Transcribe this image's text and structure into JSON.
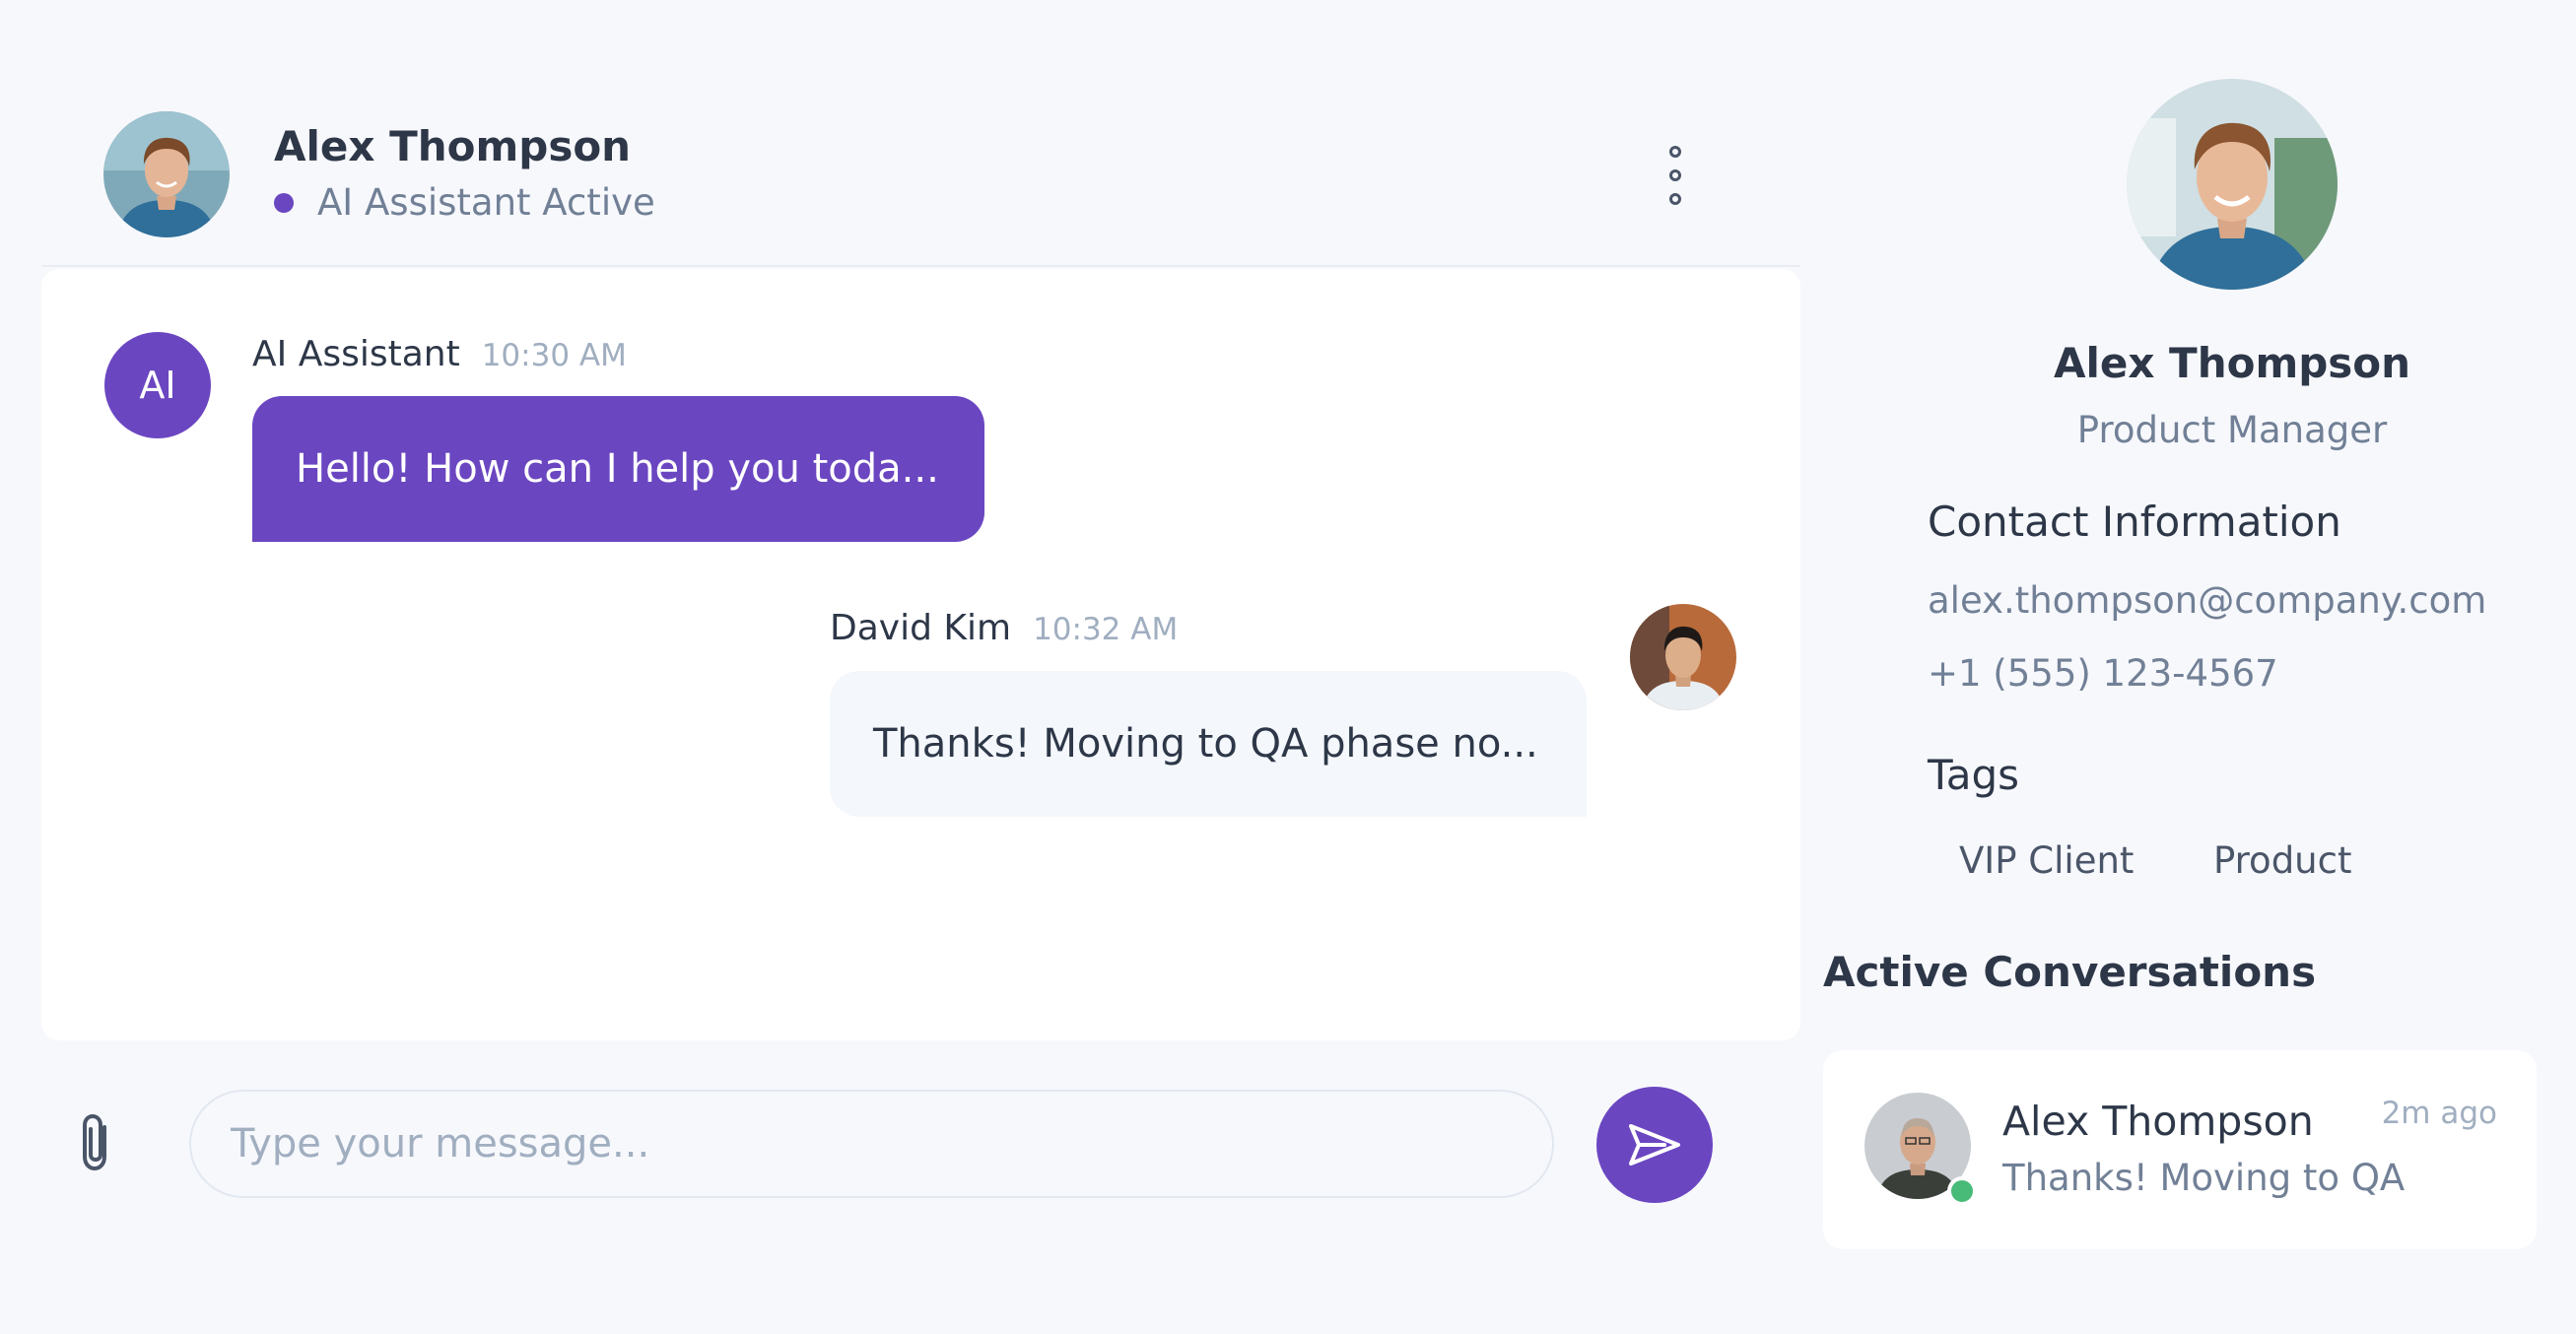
{
  "colors": {
    "accent": "#6b46c1",
    "background": "#f7f8fc",
    "panel": "#ffffff",
    "online": "#48bb78"
  },
  "chat_header": {
    "name": "Alex Thompson",
    "status": "AI Assistant Active",
    "menu_icon": "more-vertical-icon"
  },
  "messages": [
    {
      "avatar_initials": "AI",
      "sender": "AI Assistant",
      "time": "10:30 AM",
      "text": "Hello! How can I help you toda..."
    },
    {
      "sender": "David Kim",
      "time": "10:32 AM",
      "text": "Thanks! Moving to QA phase no..."
    }
  ],
  "composer": {
    "attach_icon": "paperclip-icon",
    "placeholder": "Type your message...",
    "send_icon": "send-icon"
  },
  "profile": {
    "name": "Alex Thompson",
    "role": "Product Manager",
    "contact_title": "Contact Information",
    "email": "alex.thompson@company.com",
    "phone": "+1 (555) 123-4567",
    "tags_title": "Tags",
    "tags": [
      "VIP Client",
      "Product"
    ]
  },
  "active_conversations": {
    "title": "Active Conversations",
    "items": [
      {
        "name": "Alex Thompson",
        "preview": "Thanks! Moving to QA",
        "time": "2m ago"
      }
    ]
  }
}
